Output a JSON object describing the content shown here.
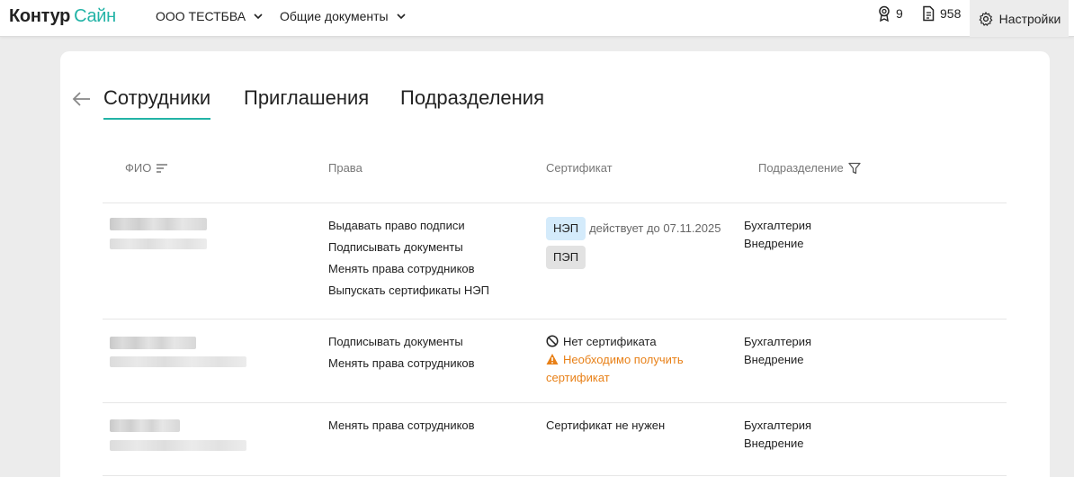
{
  "header": {
    "logo_part1": "Контур",
    "logo_part2": "Сайн",
    "org_dropdown": "ООО ТЕСТБВА",
    "docs_dropdown": "Общие документы",
    "badge_count": "9",
    "docs_count": "958",
    "settings_label": "Настройки"
  },
  "tabs": [
    {
      "label": "Сотрудники"
    },
    {
      "label": "Приглашения"
    },
    {
      "label": "Подразделения"
    }
  ],
  "table": {
    "columns": {
      "name": "ФИО",
      "rights": "Права",
      "certificate": "Сертификат",
      "department": "Подразделение"
    },
    "rows": [
      {
        "rights": [
          "Выдавать право подписи",
          "Подписывать документы",
          "Менять права сотрудников",
          "Выпускать сертификаты НЭП"
        ],
        "cert_badge_1": "НЭП",
        "cert_validity": "действует до 07.11.2025",
        "cert_badge_2": "ПЭП",
        "departments": [
          "Бухгалтерия",
          "Внедрение"
        ]
      },
      {
        "rights": [
          "Подписывать документы",
          "Менять права сотрудников"
        ],
        "cert_status": "Нет сертификата",
        "cert_warning": "Необходимо получить сертификат",
        "departments": [
          "Бухгалтерия",
          "Внедрение"
        ]
      },
      {
        "rights": [
          "Менять права сотрудников"
        ],
        "cert_status": "Сертификат не нужен",
        "departments": [
          "Бухгалтерия",
          "Внедрение"
        ]
      }
    ]
  },
  "colors": {
    "accent": "#22b3a6",
    "warning": "#e88017",
    "nep_badge": "#d4ebfb",
    "pep_badge": "#e2e2e2"
  }
}
